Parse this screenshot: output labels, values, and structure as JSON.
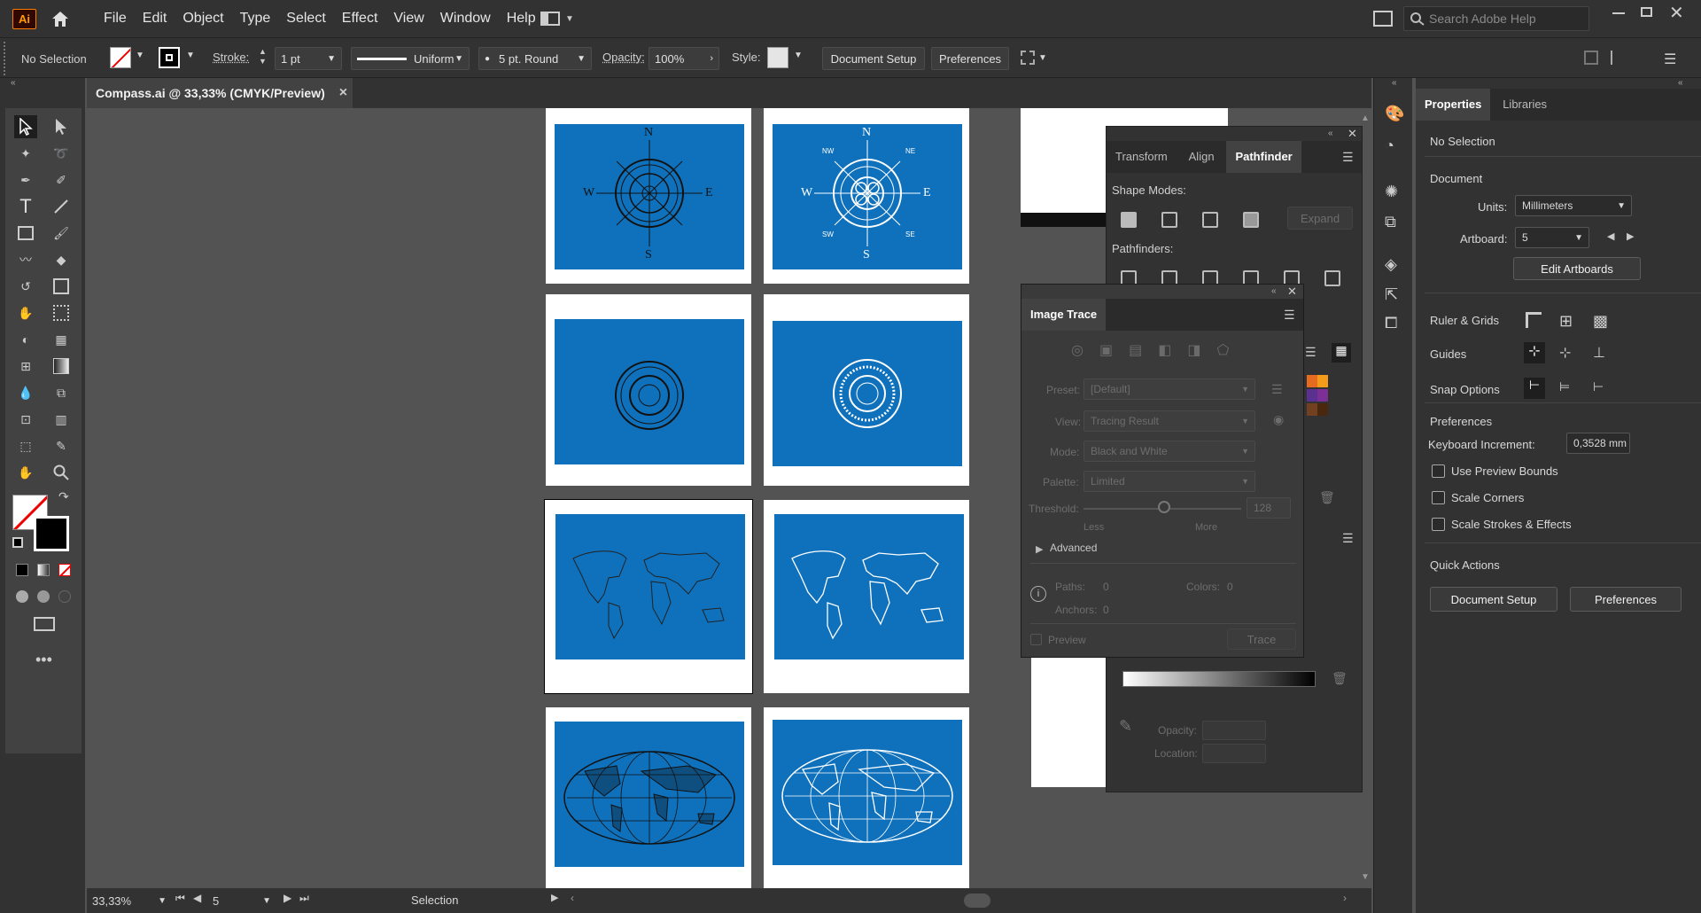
{
  "app": {
    "logo": "Ai"
  },
  "menu": [
    "File",
    "Edit",
    "Object",
    "Type",
    "Select",
    "Effect",
    "View",
    "Window",
    "Help"
  ],
  "search": {
    "placeholder": "Search Adobe Help"
  },
  "control": {
    "selection": "No Selection",
    "stroke_label": "Stroke:",
    "stroke_value": "1 pt",
    "profile": "Uniform",
    "brush": "5 pt. Round",
    "opacity_label": "Opacity:",
    "opacity_value": "100%",
    "style_label": "Style:",
    "doc_setup": "Document Setup",
    "preferences": "Preferences"
  },
  "document_tab": {
    "title": "Compass.ai @ 33,33% (CMYK/Preview)",
    "close": "×"
  },
  "status": {
    "zoom": "33,33%",
    "artboard": "5",
    "mode": "Selection"
  },
  "compass_labels": {
    "n": "N",
    "s": "S",
    "e": "E",
    "w": "W",
    "nw": "NW",
    "ne": "NE",
    "sw": "SW",
    "se": "SE"
  },
  "pathfinder": {
    "tabs": [
      "Transform",
      "Align",
      "Pathfinder"
    ],
    "shape_modes": "Shape Modes:",
    "pathfinders": "Pathfinders:",
    "expand": "Expand"
  },
  "image_trace": {
    "title": "Image Trace",
    "preset_label": "Preset:",
    "preset": "[Default]",
    "view_label": "View:",
    "view": "Tracing Result",
    "mode_label": "Mode:",
    "mode": "Black and White",
    "palette_label": "Palette:",
    "palette": "Limited",
    "threshold_label": "Threshold:",
    "threshold": "128",
    "less": "Less",
    "more": "More",
    "advanced": "Advanced",
    "paths_label": "Paths:",
    "paths": "0",
    "colors_label": "Colors:",
    "colors": "0",
    "anchors_label": "Anchors:",
    "anchors": "0",
    "preview": "Preview",
    "trace": "Trace"
  },
  "gradient": {
    "opacity_label": "Opacity:",
    "location_label": "Location:"
  },
  "properties": {
    "tabs": [
      "Properties",
      "Libraries"
    ],
    "selection": "No Selection",
    "document": "Document",
    "units_label": "Units:",
    "units": "Millimeters",
    "artboard_label": "Artboard:",
    "artboard": "5",
    "edit_artboards": "Edit Artboards",
    "ruler_grids": "Ruler & Grids",
    "guides": "Guides",
    "snap_options": "Snap Options",
    "preferences": "Preferences",
    "keyboard_increment_label": "Keyboard Increment:",
    "keyboard_increment": "0,3528 mm",
    "use_preview_bounds": "Use Preview Bounds",
    "scale_corners": "Scale Corners",
    "scale_strokes": "Scale Strokes & Effects",
    "quick_actions": "Quick Actions",
    "doc_setup": "Document Setup",
    "prefs_button": "Preferences"
  },
  "colors": {
    "accent": "#0f71bc",
    "ui_dark": "#323232",
    "canvas": "#535353"
  }
}
